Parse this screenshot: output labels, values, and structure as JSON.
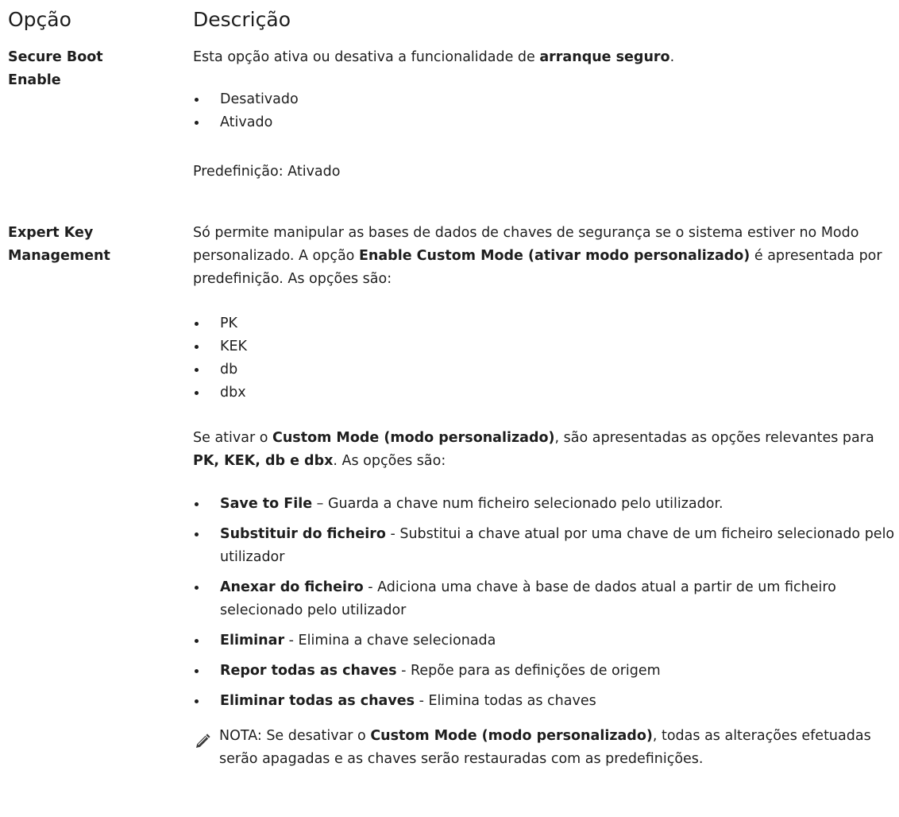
{
  "header": {
    "col_option": "Opção",
    "col_description": "Descrição"
  },
  "secure_boot": {
    "option": "Secure Boot Enable",
    "desc_pre": "Esta opção ativa ou desativa a funcionalidade de ",
    "desc_bold": "arranque seguro",
    "desc_post": ".",
    "items": [
      "Desativado",
      "Ativado"
    ],
    "default": "Predefinição: Ativado"
  },
  "expert_key": {
    "option": "Expert Key Management",
    "p1_pre": "Só permite manipular as bases de dados de chaves de segurança se o sistema estiver no Modo personalizado. A opção ",
    "p1_bold": "Enable Custom Mode (ativar modo personalizado)",
    "p1_post": " é apresentada por predefinição. As opções são:",
    "keys": [
      "PK",
      "KEK",
      "db",
      "dbx"
    ],
    "p2_pre": "Se ativar o ",
    "p2_bold1": "Custom Mode (modo personalizado)",
    "p2_mid": ", são apresentadas as opções relevantes para ",
    "p2_bold2": "PK, KEK, db e dbx",
    "p2_post": ". As opções são:",
    "actions": [
      {
        "name": "Save to File",
        "text": " – Guarda a chave num ficheiro selecionado pelo utilizador."
      },
      {
        "name": "Substituir do ficheiro",
        "text": " - Substitui a chave atual por uma chave de um ficheiro selecionado pelo utilizador"
      },
      {
        "name": "Anexar do ficheiro",
        "text": " - Adiciona uma chave à base de dados atual a partir de um ficheiro selecionado pelo utilizador"
      },
      {
        "name": "Eliminar",
        "text": " - Elimina a chave selecionada"
      },
      {
        "name": "Repor todas as chaves",
        "text": " - Repõe para as definições de origem"
      },
      {
        "name": "Eliminar todas as chaves",
        "text": " - Elimina todas as chaves"
      }
    ],
    "note_label": "NOTA:",
    "note_pre": " Se desativar o ",
    "note_bold": "Custom Mode (modo personalizado)",
    "note_post": ", todas as alterações efetuadas serão apagadas e as chaves serão restauradas com as predefinições.",
    "note_icon": "pencil-icon"
  }
}
